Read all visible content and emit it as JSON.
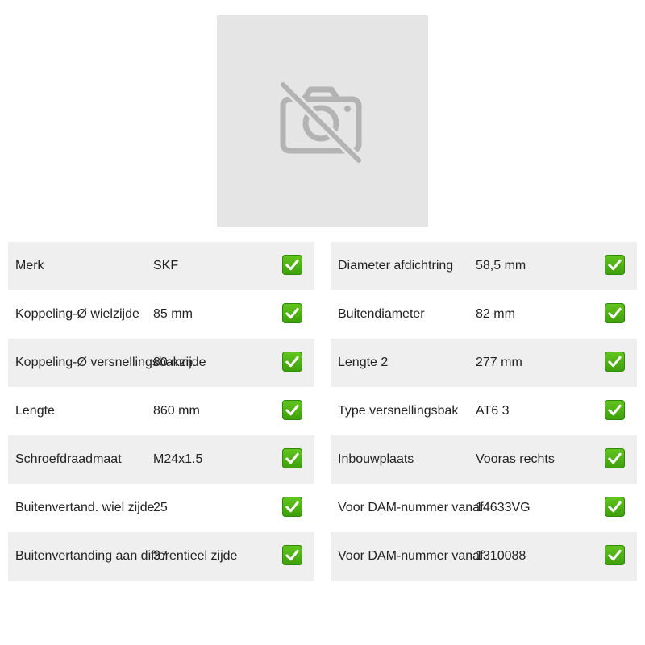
{
  "product_image": {
    "icon": "no-photo-icon"
  },
  "specs_left": [
    {
      "label": "Merk",
      "value": "SKF",
      "status_icon": "check-mark-icon"
    },
    {
      "label": "Koppeling-Ø wielzijde",
      "value": "85 mm",
      "status_icon": "check-mark-icon"
    },
    {
      "label": "Koppeling-Ø versnellingsbakzijde",
      "value": "80 mm",
      "status_icon": "check-mark-icon"
    },
    {
      "label": "Lengte",
      "value": "860 mm",
      "status_icon": "check-mark-icon"
    },
    {
      "label": "Schroefdraadmaat",
      "value": "M24x1.5",
      "status_icon": "check-mark-icon"
    },
    {
      "label": "Buitenvertand. wiel zijde",
      "value": "25",
      "status_icon": "check-mark-icon"
    },
    {
      "label": "Buitenvertanding aan differentieel zijde",
      "value": "37",
      "status_icon": "check-mark-icon"
    }
  ],
  "specs_right": [
    {
      "label": "Diameter afdichtring",
      "value": "58,5 mm",
      "status_icon": "check-mark-icon"
    },
    {
      "label": "Buitendiameter",
      "value": "82 mm",
      "status_icon": "check-mark-icon"
    },
    {
      "label": "Lengte 2",
      "value": "277 mm",
      "status_icon": "check-mark-icon"
    },
    {
      "label": "Type versnellingsbak",
      "value": "AT6 3",
      "status_icon": "check-mark-icon"
    },
    {
      "label": "Inbouwplaats",
      "value": "Vooras rechts",
      "status_icon": "check-mark-icon"
    },
    {
      "label": "Voor DAM-nummer vanaf",
      "value": "14633VG",
      "status_icon": "check-mark-icon"
    },
    {
      "label": "Voor DAM-nummer vanaf",
      "value": "1310088",
      "status_icon": "check-mark-icon"
    }
  ],
  "colors": {
    "row_shade": "#efefef",
    "placeholder_bg": "#e5e5e5",
    "placeholder_icon": "#b3b3b3",
    "check_green": "#4caf1a"
  }
}
